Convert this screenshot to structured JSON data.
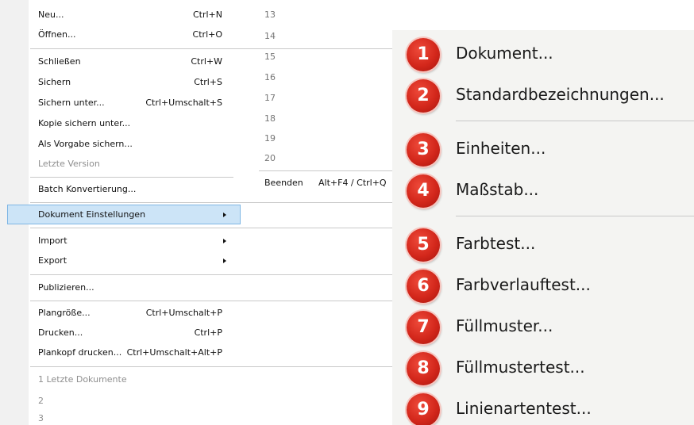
{
  "file_menu": {
    "items": [
      {
        "label": "Neu...",
        "shortcut": "Ctrl+N"
      },
      {
        "label": "Öffnen...",
        "shortcut": "Ctrl+O"
      },
      {
        "label": "Schließen",
        "shortcut": "Ctrl+W"
      },
      {
        "label": "Sichern",
        "shortcut": "Ctrl+S"
      },
      {
        "label": "Sichern unter...",
        "shortcut": "Ctrl+Umschalt+S"
      },
      {
        "label": "Kopie sichern unter...",
        "shortcut": ""
      },
      {
        "label": "Als Vorgabe sichern...",
        "shortcut": ""
      },
      {
        "label": "Letzte Version",
        "shortcut": "",
        "disabled": true
      },
      {
        "label": "Batch Konvertierung...",
        "shortcut": ""
      },
      {
        "label": "Dokument Einstellungen",
        "shortcut": "",
        "submenu": true,
        "highlighted": true
      },
      {
        "label": "Import",
        "shortcut": "",
        "submenu": true
      },
      {
        "label": "Export",
        "shortcut": "",
        "submenu": true
      },
      {
        "label": "Publizieren...",
        "shortcut": ""
      },
      {
        "label": "Plangröße...",
        "shortcut": "Ctrl+Umschalt+P"
      },
      {
        "label": "Drucken...",
        "shortcut": "Ctrl+P"
      },
      {
        "label": "Plankopf drucken...",
        "shortcut": "Ctrl+Umschalt+Alt+P"
      },
      {
        "label": "1 Letzte Dokumente",
        "shortcut": "",
        "disabled": true
      },
      {
        "label": "2",
        "shortcut": "",
        "disabled": true
      },
      {
        "label": "3",
        "shortcut": "",
        "disabled": true
      }
    ],
    "recent_numbers": [
      "13",
      "14",
      "15",
      "16",
      "17",
      "18",
      "19",
      "20"
    ],
    "quit": {
      "label": "Beenden",
      "shortcut": "Alt+F4 / Ctrl+Q"
    }
  },
  "submenu": {
    "items": [
      {
        "number": "1",
        "label": "Dokument..."
      },
      {
        "number": "2",
        "label": "Standardbezeichnungen..."
      },
      {
        "number": "3",
        "label": "Einheiten..."
      },
      {
        "number": "4",
        "label": "Maßstab..."
      },
      {
        "number": "5",
        "label": "Farbtest..."
      },
      {
        "number": "6",
        "label": "Farbverlauftest..."
      },
      {
        "number": "7",
        "label": "Füllmuster..."
      },
      {
        "number": "8",
        "label": "Füllmustertest..."
      },
      {
        "number": "9",
        "label": "Linienartentest..."
      }
    ]
  },
  "colors": {
    "highlight": "#cce4f7",
    "badge": "#d3271b"
  }
}
